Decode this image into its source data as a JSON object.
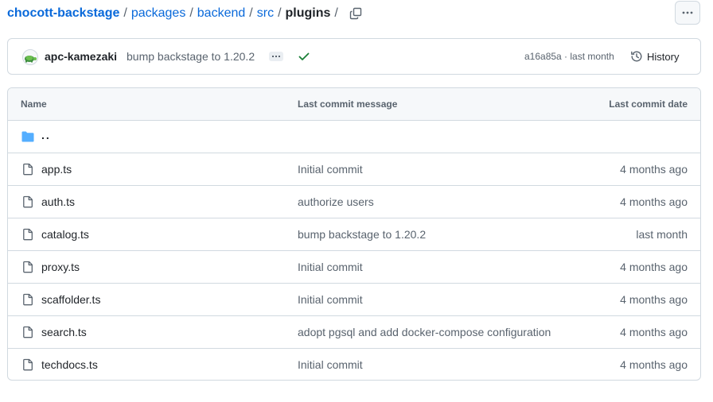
{
  "breadcrumb": {
    "repo": "chocott-backstage",
    "segments": [
      "packages",
      "backend",
      "src"
    ],
    "current": "plugins",
    "separator": "/"
  },
  "icons": {
    "copy": "copy-icon",
    "more": "kebab-horizontal-icon",
    "folder": "folder-icon",
    "file": "file-icon",
    "check": "check-icon",
    "history": "history-icon"
  },
  "colors": {
    "link": "#0969da",
    "muted": "#59636e",
    "border": "#d1d9e0",
    "header_bg": "#f6f8fa",
    "success": "#1a7f37",
    "folder": "#54aeff"
  },
  "latest_commit": {
    "author": "apc-kamezaki",
    "message": "bump backstage to 1.20.2",
    "sha": "a16a85a",
    "meta_separator": " · ",
    "time": "last month",
    "history_label": "History"
  },
  "table": {
    "headers": {
      "name": "Name",
      "message": "Last commit message",
      "date": "Last commit date"
    },
    "parent_dir": "..",
    "rows": [
      {
        "name": "app.ts",
        "message": "Initial commit",
        "date": "4 months ago"
      },
      {
        "name": "auth.ts",
        "message": "authorize users",
        "date": "4 months ago"
      },
      {
        "name": "catalog.ts",
        "message": "bump backstage to 1.20.2",
        "date": "last month"
      },
      {
        "name": "proxy.ts",
        "message": "Initial commit",
        "date": "4 months ago"
      },
      {
        "name": "scaffolder.ts",
        "message": "Initial commit",
        "date": "4 months ago"
      },
      {
        "name": "search.ts",
        "message": "adopt pgsql and add docker-compose configuration",
        "date": "4 months ago"
      },
      {
        "name": "techdocs.ts",
        "message": "Initial commit",
        "date": "4 months ago"
      }
    ]
  }
}
